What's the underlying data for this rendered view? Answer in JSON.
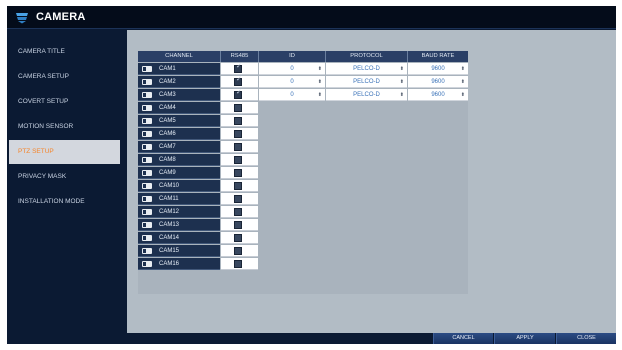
{
  "window": {
    "title": "CAMERA",
    "logo_icon": "camera-logo-icon"
  },
  "sidebar": {
    "items": [
      {
        "label": "CAMERA TITLE",
        "active": false
      },
      {
        "label": "CAMERA SETUP",
        "active": false
      },
      {
        "label": "COVERT SETUP",
        "active": false
      },
      {
        "label": "MOTION SENSOR",
        "active": false
      },
      {
        "label": "PTZ SETUP",
        "active": true
      },
      {
        "label": "PRIVACY MASK",
        "active": false
      },
      {
        "label": "INSTALLATION MODE",
        "active": false
      }
    ],
    "active_color": "#f5852b"
  },
  "table": {
    "headers": {
      "channel": "CHANNEL",
      "rs485": "RS485",
      "id": "ID",
      "protocol": "PROTOCOL",
      "baud": "BAUD RATE"
    },
    "rows": [
      {
        "channel": "CAM1",
        "rs485": true,
        "enabled": true,
        "id": "0",
        "protocol": "PELCO-D",
        "baud": "9600"
      },
      {
        "channel": "CAM2",
        "rs485": true,
        "enabled": true,
        "id": "0",
        "protocol": "PELCO-D",
        "baud": "9600"
      },
      {
        "channel": "CAM3",
        "rs485": true,
        "enabled": true,
        "id": "0",
        "protocol": "PELCO-D",
        "baud": "9600"
      },
      {
        "channel": "CAM4",
        "rs485": false,
        "enabled": false,
        "id": "",
        "protocol": "",
        "baud": ""
      },
      {
        "channel": "CAM5",
        "rs485": false,
        "enabled": false,
        "id": "",
        "protocol": "",
        "baud": ""
      },
      {
        "channel": "CAM6",
        "rs485": false,
        "enabled": false,
        "id": "",
        "protocol": "",
        "baud": ""
      },
      {
        "channel": "CAM7",
        "rs485": false,
        "enabled": false,
        "id": "",
        "protocol": "",
        "baud": ""
      },
      {
        "channel": "CAM8",
        "rs485": false,
        "enabled": false,
        "id": "",
        "protocol": "",
        "baud": ""
      },
      {
        "channel": "CAM9",
        "rs485": false,
        "enabled": false,
        "id": "",
        "protocol": "",
        "baud": ""
      },
      {
        "channel": "CAM10",
        "rs485": false,
        "enabled": false,
        "id": "",
        "protocol": "",
        "baud": ""
      },
      {
        "channel": "CAM11",
        "rs485": false,
        "enabled": false,
        "id": "",
        "protocol": "",
        "baud": ""
      },
      {
        "channel": "CAM12",
        "rs485": false,
        "enabled": false,
        "id": "",
        "protocol": "",
        "baud": ""
      },
      {
        "channel": "CAM13",
        "rs485": false,
        "enabled": false,
        "id": "",
        "protocol": "",
        "baud": ""
      },
      {
        "channel": "CAM14",
        "rs485": false,
        "enabled": false,
        "id": "",
        "protocol": "",
        "baud": ""
      },
      {
        "channel": "CAM15",
        "rs485": false,
        "enabled": false,
        "id": "",
        "protocol": "",
        "baud": ""
      },
      {
        "channel": "CAM16",
        "rs485": false,
        "enabled": false,
        "id": "",
        "protocol": "",
        "baud": ""
      }
    ],
    "field_value_color": "#3a72b8"
  },
  "footer": {
    "cancel_label": "CANCEL",
    "apply_label": "APPLY",
    "close_label": "CLOSE"
  }
}
